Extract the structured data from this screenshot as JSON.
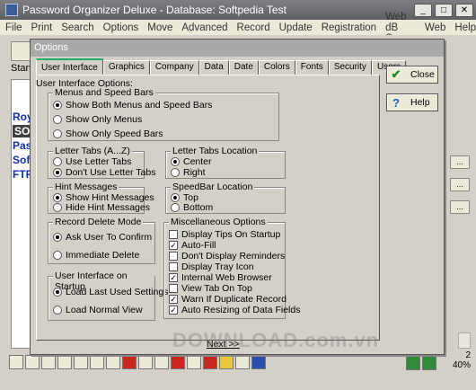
{
  "window": {
    "title": "Password Organizer Deluxe - Database: Softpedia Test",
    "controls": [
      "_",
      "□",
      "✕"
    ]
  },
  "menu": [
    "File",
    "Print",
    "Search",
    "Options",
    "Move",
    "Advanced",
    "Record",
    "Update",
    "Registration",
    "Web dB Server",
    "Web",
    "Help"
  ],
  "main": {
    "stand_label": "Stanc",
    "records": [
      "Roy",
      "SOF",
      "Pass",
      "Soft",
      "FTP"
    ],
    "zoom": "40%",
    "page": "2"
  },
  "dialog": {
    "title": "Options",
    "tabs": [
      "User Interface",
      "Graphics",
      "Company",
      "Data",
      "Date",
      "Colors",
      "Fonts",
      "Security",
      "Users"
    ],
    "active_tab": "User Interface",
    "panel_label": "User Interface Options:",
    "groups": {
      "menus": {
        "title": "Menus and Speed Bars",
        "options": [
          {
            "label": "Show Both Menus and Speed Bars",
            "checked": true
          },
          {
            "label": "Show Only Menus",
            "checked": false
          },
          {
            "label": "Show Only Speed Bars",
            "checked": false
          }
        ]
      },
      "letter_tabs": {
        "title": "Letter Tabs (A...Z)",
        "options": [
          {
            "label": "Use Letter Tabs",
            "checked": false
          },
          {
            "label": "Don't Use Letter Tabs",
            "checked": true
          }
        ]
      },
      "letter_tabs_location": {
        "title": "Letter Tabs Location",
        "options": [
          {
            "label": "Center",
            "checked": true
          },
          {
            "label": "Right",
            "checked": false
          }
        ]
      },
      "hint_messages": {
        "title": "Hint Messages",
        "options": [
          {
            "label": "Show Hint Messages",
            "checked": true
          },
          {
            "label": "Hide Hint Messages",
            "checked": false
          }
        ]
      },
      "speedbar_location": {
        "title": "SpeedBar Location",
        "options": [
          {
            "label": "Top",
            "checked": true
          },
          {
            "label": "Bottom",
            "checked": false
          }
        ]
      },
      "record_delete": {
        "title": "Record Delete Mode",
        "options": [
          {
            "label": "Ask User To Confirm",
            "checked": true
          },
          {
            "label": "Immediate Delete",
            "checked": false
          }
        ]
      },
      "ui_startup": {
        "title": "User Interface on Startup",
        "options": [
          {
            "label": "Load Last Used Settings",
            "checked": true
          },
          {
            "label": "Load Normal View",
            "checked": false
          }
        ]
      },
      "misc": {
        "title": "Miscellaneous Options",
        "options": [
          {
            "label": "Display Tips On Startup",
            "checked": false
          },
          {
            "label": "Auto-Fill",
            "checked": true
          },
          {
            "label": "Don't Display Reminders",
            "checked": false
          },
          {
            "label": "Display Tray Icon",
            "checked": false
          },
          {
            "label": "Internal Web Browser",
            "checked": true
          },
          {
            "label": "View Tab On Top",
            "checked": false
          },
          {
            "label": "Warn If Duplicate Record",
            "checked": true
          },
          {
            "label": "Auto Resizing of Data Fields",
            "checked": true
          }
        ]
      }
    },
    "buttons": {
      "close": "Close",
      "help": "Help",
      "next": "Next >>"
    },
    "watermark": "DOWNLOAD.com.vn"
  }
}
